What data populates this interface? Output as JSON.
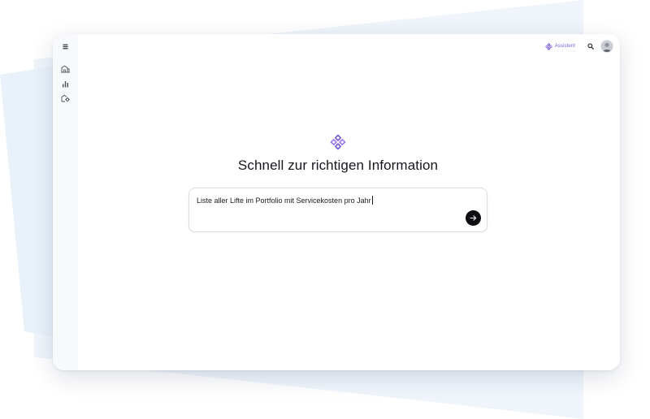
{
  "topbar": {
    "assistant_label": "Assistent"
  },
  "icons": {
    "menu": "hamburger-menu-icon",
    "buildings": "buildings-icon",
    "chart": "bar-chart-icon",
    "settings": "building-settings-icon",
    "assistant": "assistant-logo-icon",
    "search": "search-icon",
    "send": "arrow-right-icon"
  },
  "main": {
    "headline": "Schnell zur richtigen Information",
    "prompt": {
      "value": "Liste aller Lifte im Portfolio mit Servicekosten pro Jahr"
    }
  },
  "colors": {
    "accent": "#7b5bd6",
    "accent_secondary": "#9d7be8",
    "text": "#16161d",
    "send_button": "#0d0d12",
    "sidebar_bg": "#f7f9fc"
  }
}
